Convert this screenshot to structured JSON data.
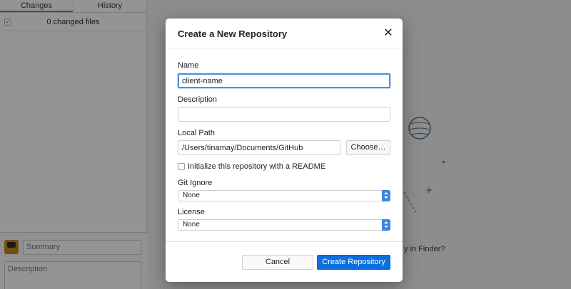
{
  "sidebar": {
    "tabs": [
      {
        "label": "Changes"
      },
      {
        "label": "History"
      }
    ],
    "changed_files": "0 changed files",
    "commit": {
      "summary_placeholder": "Summary",
      "description_placeholder": "Description"
    }
  },
  "main": {
    "finder_hint": "y in Finder?"
  },
  "dialog": {
    "title": "Create a New Repository",
    "close_icon": "close-icon",
    "name": {
      "label": "Name",
      "value": "client-name"
    },
    "description": {
      "label": "Description",
      "value": ""
    },
    "local_path": {
      "label": "Local Path",
      "value": "/Users/tinamay/Documents/GitHub",
      "choose_label": "Choose…"
    },
    "readme": {
      "label": "Initialize this repository with a README",
      "checked": false
    },
    "git_ignore": {
      "label": "Git Ignore",
      "selected": "None"
    },
    "license": {
      "label": "License",
      "selected": "None"
    },
    "buttons": {
      "cancel": "Cancel",
      "create": "Create Repository"
    }
  },
  "colors": {
    "accent": "#0c6fdd",
    "focus_ring": "#4d8fe0"
  }
}
